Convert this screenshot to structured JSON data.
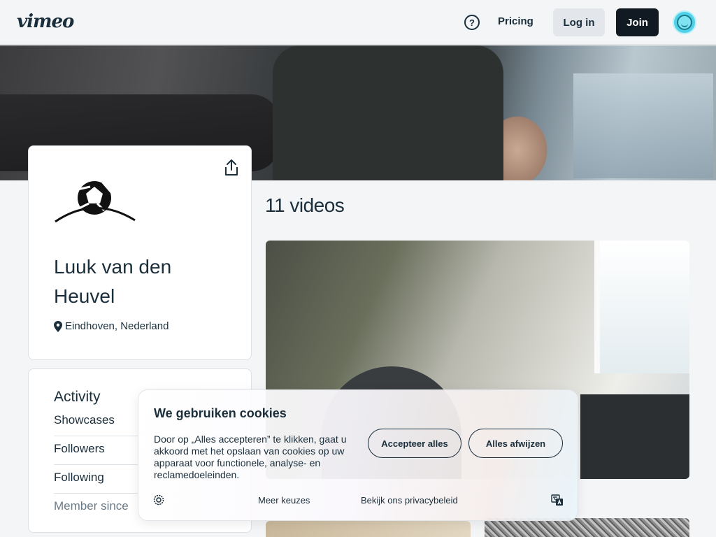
{
  "header": {
    "logo": "vimeo",
    "help_icon": "?",
    "pricing": "Pricing",
    "login": "Log in",
    "join": "Join"
  },
  "profile": {
    "name": "Luuk van den Heuvel",
    "location": "Eindhoven, Nederland"
  },
  "activity": {
    "title": "Activity",
    "items": [
      "Showcases",
      "Followers",
      "Following",
      "Member since"
    ]
  },
  "videos": {
    "heading": "11 videos"
  },
  "cookie": {
    "title": "We gebruiken cookies",
    "text": "Door op „Alles accepteren” te klikken, gaat u akkoord met het opslaan van cookies op uw apparaat voor functionele, analyse- en reclamedoeleinden.",
    "accept": "Accepteer alles",
    "reject": "Alles afwijzen",
    "more_choices": "Meer keuzes",
    "privacy": "Bekijk ons privacybeleid"
  },
  "icons": {
    "help": "help-icon",
    "avatar": "avatar-icon",
    "share": "share-icon",
    "location": "location-pin-icon",
    "cookie_settings": "settings-icon",
    "translate": "translate-icon"
  }
}
